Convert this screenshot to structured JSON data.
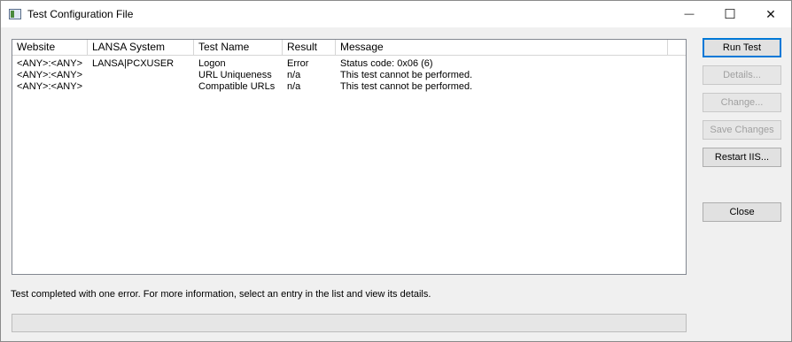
{
  "window": {
    "title": "Test Configuration File",
    "controls": {
      "minimize": "—",
      "maximize": "☐",
      "close": "✕"
    }
  },
  "table": {
    "columns": [
      "Website",
      "LANSA System",
      "Test Name",
      "Result",
      "Message"
    ],
    "rows": [
      [
        "<ANY>:<ANY>",
        "LANSA|PCXUSER",
        "Logon",
        "Error",
        "Status code: 0x06 (6)"
      ],
      [
        "<ANY>:<ANY>",
        "",
        "URL Uniqueness",
        "n/a",
        "This test cannot be performed."
      ],
      [
        "<ANY>:<ANY>",
        "",
        "Compatible URLs",
        "n/a",
        "This test cannot be performed."
      ]
    ]
  },
  "buttons": {
    "run_test": "Run Test",
    "details": "Details...",
    "change": "Change...",
    "save_changes": "Save Changes",
    "restart_iis": "Restart IIS...",
    "close": "Close"
  },
  "status_text": "Test completed with one error. For more information, select an entry in the list and view its details.",
  "colors": {
    "accent": "#0078d7",
    "disabled_text": "#a0a0a0"
  }
}
